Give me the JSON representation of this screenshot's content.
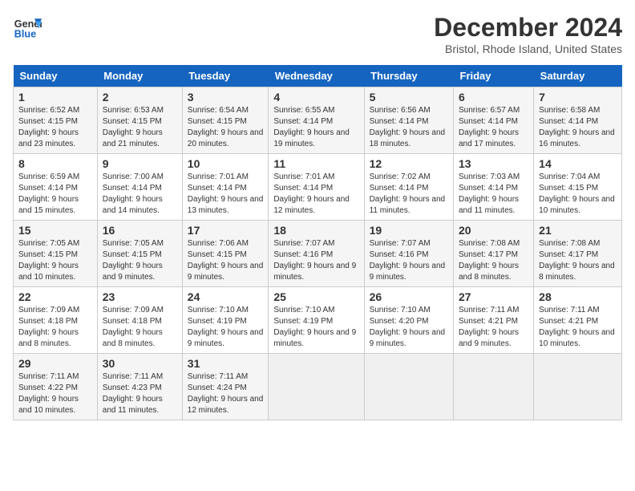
{
  "logo": {
    "line1": "General",
    "line2": "Blue"
  },
  "title": "December 2024",
  "subtitle": "Bristol, Rhode Island, United States",
  "days_of_week": [
    "Sunday",
    "Monday",
    "Tuesday",
    "Wednesday",
    "Thursday",
    "Friday",
    "Saturday"
  ],
  "weeks": [
    [
      {
        "day": "1",
        "sunrise": "6:52 AM",
        "sunset": "4:15 PM",
        "daylight": "9 hours and 23 minutes."
      },
      {
        "day": "2",
        "sunrise": "6:53 AM",
        "sunset": "4:15 PM",
        "daylight": "9 hours and 21 minutes."
      },
      {
        "day": "3",
        "sunrise": "6:54 AM",
        "sunset": "4:15 PM",
        "daylight": "9 hours and 20 minutes."
      },
      {
        "day": "4",
        "sunrise": "6:55 AM",
        "sunset": "4:14 PM",
        "daylight": "9 hours and 19 minutes."
      },
      {
        "day": "5",
        "sunrise": "6:56 AM",
        "sunset": "4:14 PM",
        "daylight": "9 hours and 18 minutes."
      },
      {
        "day": "6",
        "sunrise": "6:57 AM",
        "sunset": "4:14 PM",
        "daylight": "9 hours and 17 minutes."
      },
      {
        "day": "7",
        "sunrise": "6:58 AM",
        "sunset": "4:14 PM",
        "daylight": "9 hours and 16 minutes."
      }
    ],
    [
      {
        "day": "8",
        "sunrise": "6:59 AM",
        "sunset": "4:14 PM",
        "daylight": "9 hours and 15 minutes."
      },
      {
        "day": "9",
        "sunrise": "7:00 AM",
        "sunset": "4:14 PM",
        "daylight": "9 hours and 14 minutes."
      },
      {
        "day": "10",
        "sunrise": "7:01 AM",
        "sunset": "4:14 PM",
        "daylight": "9 hours and 13 minutes."
      },
      {
        "day": "11",
        "sunrise": "7:01 AM",
        "sunset": "4:14 PM",
        "daylight": "9 hours and 12 minutes."
      },
      {
        "day": "12",
        "sunrise": "7:02 AM",
        "sunset": "4:14 PM",
        "daylight": "9 hours and 11 minutes."
      },
      {
        "day": "13",
        "sunrise": "7:03 AM",
        "sunset": "4:14 PM",
        "daylight": "9 hours and 11 minutes."
      },
      {
        "day": "14",
        "sunrise": "7:04 AM",
        "sunset": "4:15 PM",
        "daylight": "9 hours and 10 minutes."
      }
    ],
    [
      {
        "day": "15",
        "sunrise": "7:05 AM",
        "sunset": "4:15 PM",
        "daylight": "9 hours and 10 minutes."
      },
      {
        "day": "16",
        "sunrise": "7:05 AM",
        "sunset": "4:15 PM",
        "daylight": "9 hours and 9 minutes."
      },
      {
        "day": "17",
        "sunrise": "7:06 AM",
        "sunset": "4:15 PM",
        "daylight": "9 hours and 9 minutes."
      },
      {
        "day": "18",
        "sunrise": "7:07 AM",
        "sunset": "4:16 PM",
        "daylight": "9 hours and 9 minutes."
      },
      {
        "day": "19",
        "sunrise": "7:07 AM",
        "sunset": "4:16 PM",
        "daylight": "9 hours and 9 minutes."
      },
      {
        "day": "20",
        "sunrise": "7:08 AM",
        "sunset": "4:17 PM",
        "daylight": "9 hours and 8 minutes."
      },
      {
        "day": "21",
        "sunrise": "7:08 AM",
        "sunset": "4:17 PM",
        "daylight": "9 hours and 8 minutes."
      }
    ],
    [
      {
        "day": "22",
        "sunrise": "7:09 AM",
        "sunset": "4:18 PM",
        "daylight": "9 hours and 8 minutes."
      },
      {
        "day": "23",
        "sunrise": "7:09 AM",
        "sunset": "4:18 PM",
        "daylight": "9 hours and 8 minutes."
      },
      {
        "day": "24",
        "sunrise": "7:10 AM",
        "sunset": "4:19 PM",
        "daylight": "9 hours and 9 minutes."
      },
      {
        "day": "25",
        "sunrise": "7:10 AM",
        "sunset": "4:19 PM",
        "daylight": "9 hours and 9 minutes."
      },
      {
        "day": "26",
        "sunrise": "7:10 AM",
        "sunset": "4:20 PM",
        "daylight": "9 hours and 9 minutes."
      },
      {
        "day": "27",
        "sunrise": "7:11 AM",
        "sunset": "4:21 PM",
        "daylight": "9 hours and 9 minutes."
      },
      {
        "day": "28",
        "sunrise": "7:11 AM",
        "sunset": "4:21 PM",
        "daylight": "9 hours and 10 minutes."
      }
    ],
    [
      {
        "day": "29",
        "sunrise": "7:11 AM",
        "sunset": "4:22 PM",
        "daylight": "9 hours and 10 minutes."
      },
      {
        "day": "30",
        "sunrise": "7:11 AM",
        "sunset": "4:23 PM",
        "daylight": "9 hours and 11 minutes."
      },
      {
        "day": "31",
        "sunrise": "7:11 AM",
        "sunset": "4:24 PM",
        "daylight": "9 hours and 12 minutes."
      },
      null,
      null,
      null,
      null
    ]
  ],
  "labels": {
    "sunrise": "Sunrise:",
    "sunset": "Sunset:",
    "daylight": "Daylight:"
  }
}
